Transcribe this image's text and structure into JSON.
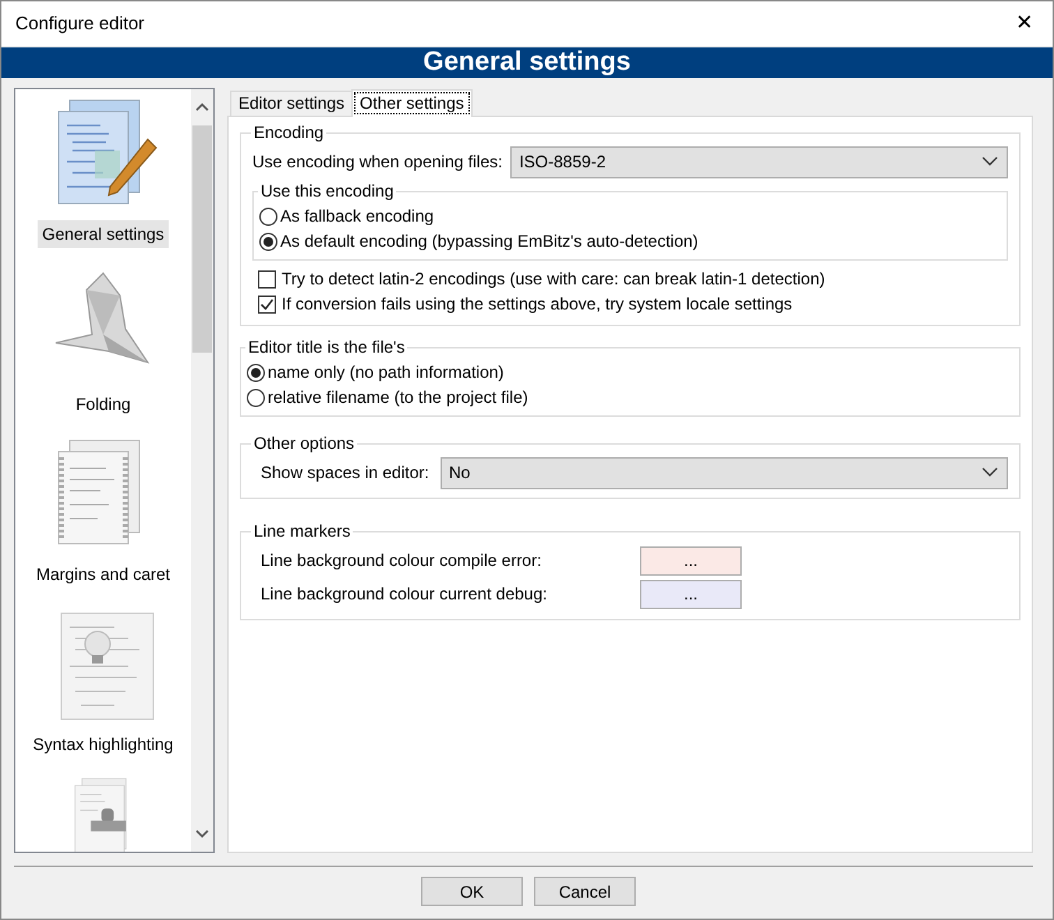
{
  "window": {
    "title": "Configure editor",
    "close": "✕"
  },
  "header": "General settings",
  "sidebar": {
    "items": [
      {
        "label": "General settings",
        "selected": true
      },
      {
        "label": "Folding",
        "selected": false
      },
      {
        "label": "Margins and caret",
        "selected": false
      },
      {
        "label": "Syntax highlighting",
        "selected": false
      },
      {
        "selected": false
      }
    ]
  },
  "tabs": [
    {
      "label": "Editor settings",
      "selected": false
    },
    {
      "label": "Other settings",
      "selected": true
    }
  ],
  "encoding": {
    "title": "Encoding",
    "label": "Use encoding when opening files:",
    "value": "ISO-8859-2",
    "use": {
      "title": "Use this encoding",
      "options": [
        {
          "label": "As fallback encoding",
          "selected": false
        },
        {
          "label": "As default encoding (bypassing EmBitz's auto-detection)",
          "selected": true
        }
      ]
    },
    "checks": [
      {
        "label": "Try to detect latin-2 encodings (use with care: can break latin-1 detection)",
        "checked": false
      },
      {
        "label": "If conversion fails using the settings above, try system locale settings",
        "checked": true
      }
    ]
  },
  "editor_title": {
    "title": "Editor title is the file's",
    "options": [
      {
        "label": "name only (no path information)",
        "selected": true
      },
      {
        "label": "relative filename (to the project file)",
        "selected": false
      }
    ]
  },
  "other_options": {
    "title": "Other options",
    "label": "Show spaces in editor:",
    "value": "No"
  },
  "line_markers": {
    "title": "Line markers",
    "rows": [
      {
        "label": "Line background colour compile error:",
        "button": "...",
        "color": "#fbe9e6"
      },
      {
        "label": "Line background colour current debug:",
        "button": "...",
        "color": "#e9e9f8"
      }
    ]
  },
  "buttons": [
    "OK",
    "Cancel"
  ]
}
